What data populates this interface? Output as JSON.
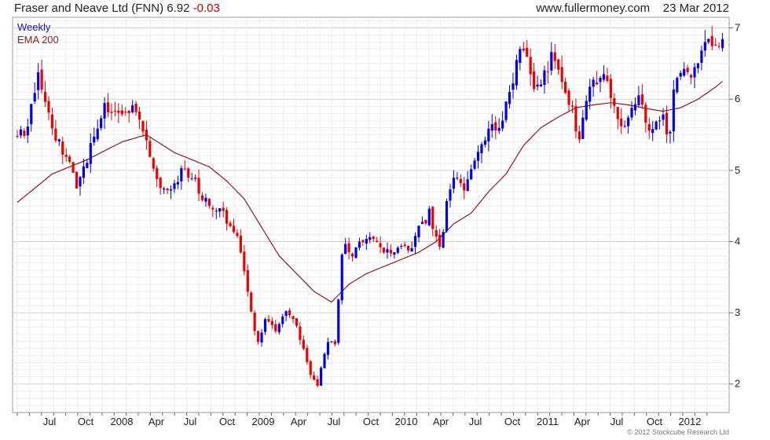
{
  "header": {
    "company": "Fraser and Neave Ltd (FNN)",
    "price": "6.92",
    "change": "-0.03",
    "website": "www.fullermoney.com",
    "date": "23 Mar 2012"
  },
  "legend": {
    "weekly": "Weekly",
    "ema": "EMA 200"
  },
  "copyright": "© 2012 Stockcube Research Ltd",
  "colors": {
    "up": "#0000ee",
    "down": "#ee0000",
    "ema": "#8b1a1a",
    "grid_major": "#cfcfcf",
    "grid_minor": "#ececec"
  },
  "chart_data": {
    "type": "candlestick",
    "title": "Fraser and Neave Ltd (FNN)",
    "frequency": "Weekly",
    "x_tick_labels": [
      "Jul",
      "Oct",
      "2008",
      "Apr",
      "Jul",
      "Oct",
      "2009",
      "Apr",
      "Jul",
      "Oct",
      "2010",
      "Apr",
      "Jul",
      "Oct",
      "2011",
      "Apr",
      "Jul",
      "Oct",
      "2012"
    ],
    "x_range": [
      "2007-05",
      "2012-03"
    ],
    "ylim": [
      1.6,
      7.15
    ],
    "y_ticks": [
      2,
      3,
      4,
      5,
      6,
      7
    ],
    "y_axis_position": "right",
    "legend_position": "top-left",
    "grid": true,
    "price_path": [
      [
        0,
        5.5
      ],
      [
        3,
        5.6
      ],
      [
        6,
        6.35
      ],
      [
        10,
        5.5
      ],
      [
        14,
        5.25
      ],
      [
        17,
        4.8
      ],
      [
        21,
        5.3
      ],
      [
        25,
        5.9
      ],
      [
        29,
        5.8
      ],
      [
        33,
        5.85
      ],
      [
        37,
        5.45
      ],
      [
        39,
        5.0
      ],
      [
        41,
        4.7
      ],
      [
        44,
        4.75
      ],
      [
        47,
        4.95
      ],
      [
        50,
        4.95
      ],
      [
        53,
        4.6
      ],
      [
        57,
        4.5
      ],
      [
        60,
        4.3
      ],
      [
        63,
        4.1
      ],
      [
        65,
        3.6
      ],
      [
        67,
        3.0
      ],
      [
        69,
        2.55
      ],
      [
        71,
        2.9
      ],
      [
        74,
        2.75
      ],
      [
        77,
        3.0
      ],
      [
        80,
        2.8
      ],
      [
        82,
        2.5
      ],
      [
        84,
        2.1
      ],
      [
        86,
        1.95
      ],
      [
        87,
        2.25
      ],
      [
        89,
        2.55
      ],
      [
        91,
        2.6
      ],
      [
        92,
        3.15
      ],
      [
        93,
        3.8
      ],
      [
        94,
        4.0
      ],
      [
        96,
        3.8
      ],
      [
        98,
        4.0
      ],
      [
        100,
        4.1
      ],
      [
        103,
        3.95
      ],
      [
        106,
        3.85
      ],
      [
        108,
        3.9
      ],
      [
        110,
        3.9
      ],
      [
        113,
        3.95
      ],
      [
        116,
        4.25
      ],
      [
        118,
        4.4
      ],
      [
        120,
        4.1
      ],
      [
        121,
        3.9
      ],
      [
        123,
        4.5
      ],
      [
        125,
        4.95
      ],
      [
        128,
        4.7
      ],
      [
        130,
        4.95
      ],
      [
        132,
        5.2
      ],
      [
        134,
        5.5
      ],
      [
        136,
        5.7
      ],
      [
        138,
        5.55
      ],
      [
        140,
        5.95
      ],
      [
        142,
        6.3
      ],
      [
        145,
        6.75
      ],
      [
        148,
        6.25
      ],
      [
        150,
        6.3
      ],
      [
        153,
        6.55
      ],
      [
        155,
        6.5
      ],
      [
        157,
        6.0
      ],
      [
        159,
        5.85
      ],
      [
        161,
        5.4
      ],
      [
        163,
        5.9
      ],
      [
        165,
        6.3
      ],
      [
        168,
        6.3
      ],
      [
        171,
        5.85
      ],
      [
        173,
        5.6
      ],
      [
        176,
        5.9
      ],
      [
        178,
        6.05
      ],
      [
        180,
        5.65
      ],
      [
        183,
        5.6
      ],
      [
        185,
        5.75
      ],
      [
        187,
        5.45
      ],
      [
        188,
        6.05
      ],
      [
        190,
        6.4
      ],
      [
        193,
        6.3
      ],
      [
        196,
        6.6
      ],
      [
        198,
        6.85
      ],
      [
        200,
        6.65
      ],
      [
        202,
        6.92
      ]
    ],
    "ema200_path": [
      [
        0,
        4.55
      ],
      [
        10,
        4.95
      ],
      [
        20,
        5.15
      ],
      [
        30,
        5.4
      ],
      [
        37,
        5.5
      ],
      [
        45,
        5.25
      ],
      [
        55,
        5.05
      ],
      [
        60,
        4.85
      ],
      [
        65,
        4.6
      ],
      [
        70,
        4.2
      ],
      [
        75,
        3.8
      ],
      [
        80,
        3.55
      ],
      [
        85,
        3.3
      ],
      [
        90,
        3.15
      ],
      [
        95,
        3.4
      ],
      [
        100,
        3.55
      ],
      [
        105,
        3.65
      ],
      [
        110,
        3.75
      ],
      [
        115,
        3.85
      ],
      [
        120,
        4.0
      ],
      [
        125,
        4.25
      ],
      [
        130,
        4.4
      ],
      [
        135,
        4.7
      ],
      [
        140,
        4.95
      ],
      [
        145,
        5.35
      ],
      [
        150,
        5.6
      ],
      [
        155,
        5.75
      ],
      [
        160,
        5.88
      ],
      [
        165,
        5.92
      ],
      [
        170,
        5.95
      ],
      [
        175,
        5.92
      ],
      [
        180,
        5.87
      ],
      [
        185,
        5.83
      ],
      [
        190,
        5.88
      ],
      [
        195,
        6.0
      ],
      [
        200,
        6.17
      ],
      [
        202,
        6.25
      ]
    ],
    "high_low_extremes": {
      "high": 6.98,
      "low": 1.88
    }
  }
}
